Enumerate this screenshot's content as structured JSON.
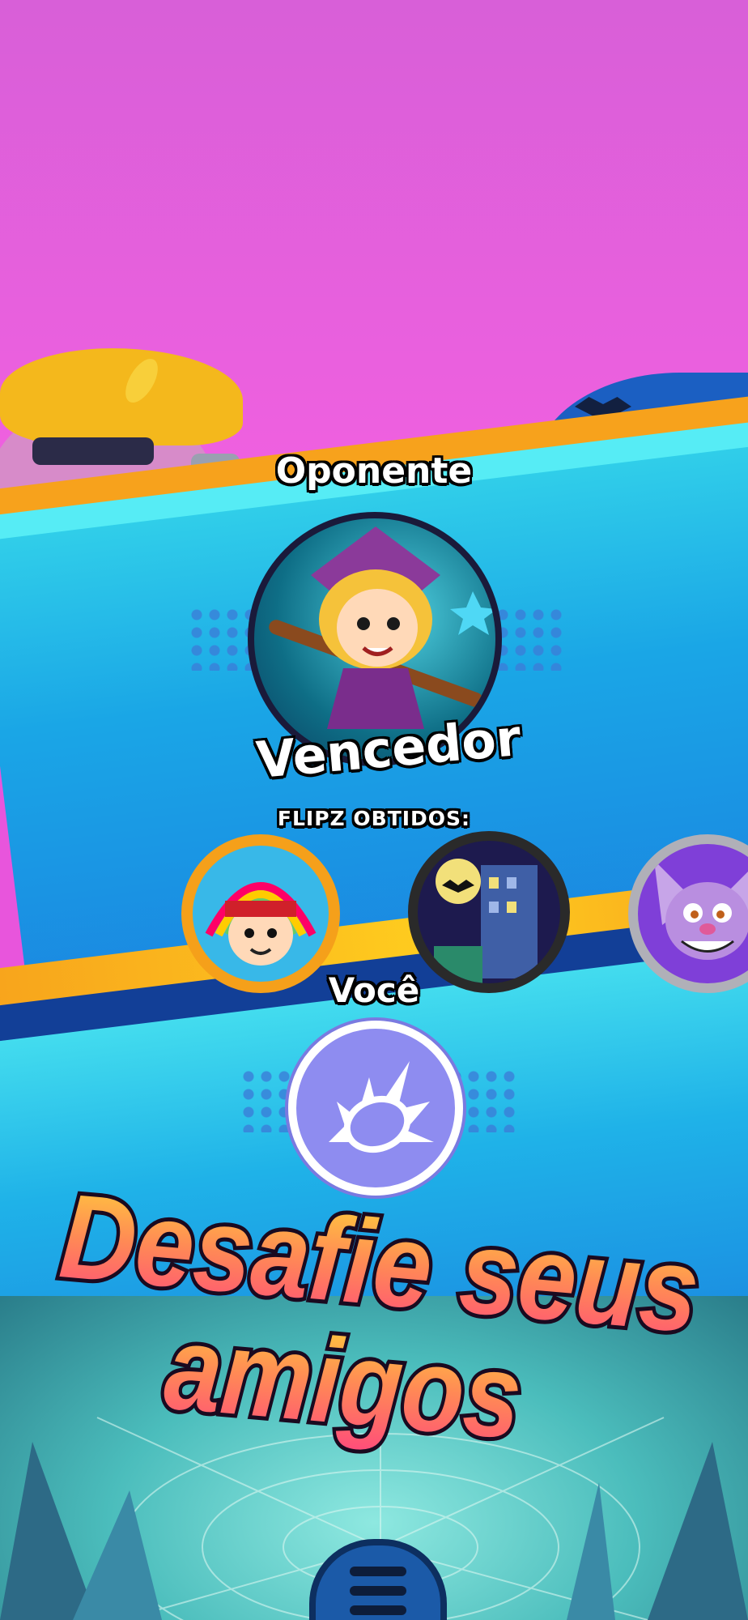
{
  "opponent": {
    "label": "Oponente",
    "status": "Vencedor"
  },
  "flipz": {
    "label": "FLIPZ OBTIDOS:",
    "items": [
      "rainbow-kid-flip",
      "haunted-building-flip",
      "bat-creature-flip"
    ]
  },
  "player": {
    "label": "Você"
  },
  "promo": {
    "line1": "Desafie seus",
    "line2": "amigos"
  },
  "menu": {
    "icon": "menu-icon"
  },
  "colors": {
    "accent_orange": "#f7a21c",
    "band_blue": "#1b7fe0",
    "background_pink": "#e855dc"
  }
}
